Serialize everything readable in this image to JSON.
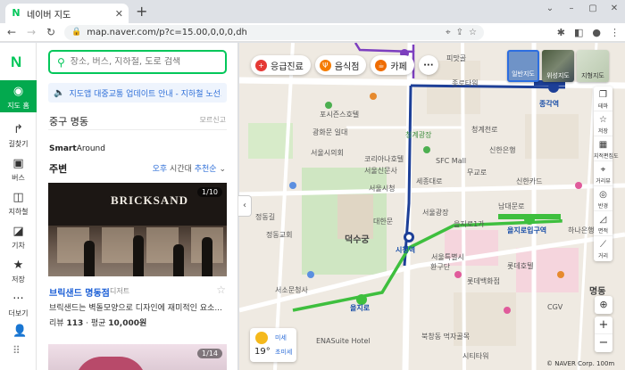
{
  "browser": {
    "tab_title": "네이버 지도",
    "url": "map.naver.com/p?c=15.00,0,0,0,dh"
  },
  "rail": {
    "logo": "N",
    "items": [
      {
        "label": "지도 홈",
        "icon": "map-pin"
      },
      {
        "label": "길찾기",
        "icon": "directions"
      },
      {
        "label": "버스",
        "icon": "bus"
      },
      {
        "label": "지하철",
        "icon": "subway"
      },
      {
        "label": "기차",
        "icon": "train"
      },
      {
        "label": "저장",
        "icon": "star"
      },
      {
        "label": "더보기",
        "icon": "more"
      }
    ]
  },
  "panel": {
    "search_placeholder": "장소, 버스, 지하철, 도로 검색",
    "notice": "지도앱 대중교통 업데이트 안내 - 지하철 노선...",
    "location": "중구 명동",
    "location_reset": "모르신고",
    "smart_bold": "Smart",
    "smart_rest": "Around",
    "nearby_title": "주변",
    "nearby_time_prefix": "오후",
    "nearby_time_mid": " 시간대 ",
    "nearby_time_suffix": "추천순",
    "photo_sign": "BRICKSAND",
    "photo_count": "1/10",
    "place_name": "브릭샌드 명동점",
    "place_category": "디저트",
    "place_desc": "브릭샌드는 벽돌모양으로 디자인에 재미적인 요소...",
    "review_label": "리뷰",
    "review_count": "113",
    "price_label": "평균",
    "price_value": "10,000원",
    "photo2_count": "1/14"
  },
  "map": {
    "chips": [
      {
        "label": "응급진료",
        "color": "#e53935",
        "icon": "cross"
      },
      {
        "label": "음식점",
        "color": "#f57c00",
        "icon": "fork"
      },
      {
        "label": "카페",
        "color": "#ef6c00",
        "icon": "cup"
      }
    ],
    "more": "···",
    "types": [
      {
        "label": "일반지도"
      },
      {
        "label": "위성지도"
      },
      {
        "label": "지형지도"
      }
    ],
    "tools": [
      {
        "label": "테마",
        "icon": "layers"
      },
      {
        "label": "저장",
        "icon": "star"
      },
      {
        "label": "지적편집도",
        "icon": "grid"
      },
      {
        "label": "거리뷰",
        "icon": "pin"
      },
      {
        "label": "반경",
        "icon": "target"
      },
      {
        "label": "면적",
        "icon": "ruler"
      },
      {
        "label": "거리",
        "icon": "ruler2"
      }
    ],
    "labels": [
      "포시즌스호텔",
      "서울시의회",
      "피맛골",
      "종각역",
      "종로타워",
      "청계광장",
      "SFC Mall",
      "을지로입구역",
      "하나은행",
      "시청역",
      "덕수궁",
      "롯데백화점",
      "명동",
      "북창동 먹자골목",
      "서울광장",
      "환구단",
      "을지로",
      "남대문로",
      "시티타워",
      "정동길",
      "세종대로",
      "CGV",
      "신한은행",
      "롯데호텔",
      "서울신문사",
      "서울시청",
      "코리아나호텔",
      "정동교회",
      "서소문청사",
      "신한카드",
      "ENASuite Hotel",
      "대한문",
      "서울특별시",
      "을지로1가",
      "광화문 일대",
      "무교로",
      "청계천로"
    ],
    "weather_temp": "19°",
    "weather_dust": "미세",
    "weather_udust": "초미세",
    "footer": "© NAVER Corp. 100m"
  }
}
